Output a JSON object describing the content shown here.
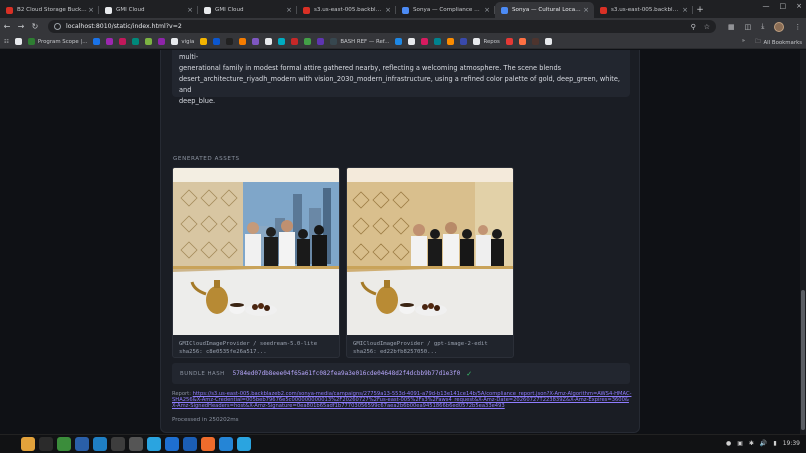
{
  "browser": {
    "tabs": [
      {
        "title": "B2 Cloud Storage Buckets",
        "color": "#d93025"
      },
      {
        "title": "GMI Cloud",
        "color": "#e8eaed"
      },
      {
        "title": "GMI Cloud",
        "color": "#e8eaed"
      },
      {
        "title": "s3.us-east-005.backblazeb2.c",
        "color": "#d93025"
      },
      {
        "title": "Sonya — Compliance Notar",
        "color": "#4c8bf5"
      },
      {
        "title": "Sonya — Cultural Localizatio",
        "color": "#4c8bf5",
        "active": true
      },
      {
        "title": "s3.us-east-005.backblazeb2.c",
        "color": "#d93025"
      }
    ],
    "url": "localhost:8010/static/index.html?v=2",
    "bookmarks": [
      {
        "label": "",
        "color": "#e8eaed"
      },
      {
        "label": "Program Scope |...",
        "color": "#2e7d32"
      },
      {
        "label": "",
        "color": "#1a73e8"
      },
      {
        "label": "",
        "color": "#9c27b0"
      },
      {
        "label": "",
        "color": "#c2185b"
      },
      {
        "label": "",
        "color": "#00897b"
      },
      {
        "label": "",
        "color": "#7cb342"
      },
      {
        "label": "",
        "color": "#8e24aa"
      },
      {
        "label": "vigia",
        "color": "#e8eaed"
      },
      {
        "label": "",
        "color": "#f4b400"
      },
      {
        "label": "",
        "color": "#0b57d0"
      },
      {
        "label": "",
        "color": "#212121"
      },
      {
        "label": "",
        "color": "#f57c00"
      },
      {
        "label": "",
        "color": "#7e57c2"
      },
      {
        "label": "",
        "color": "#e8eaed"
      },
      {
        "label": "",
        "color": "#00acc1"
      },
      {
        "label": "",
        "color": "#c62828"
      },
      {
        "label": "",
        "color": "#43a047"
      },
      {
        "label": "",
        "color": "#5e35b1"
      },
      {
        "label": "BASH REF — Ref...",
        "color": "#37474f"
      },
      {
        "label": "",
        "color": "#1e88e5"
      },
      {
        "label": "",
        "color": "#e8eaed"
      },
      {
        "label": "",
        "color": "#d81b60"
      },
      {
        "label": "",
        "color": "#00838f"
      },
      {
        "label": "",
        "color": "#fb8c00"
      },
      {
        "label": "",
        "color": "#3949ab"
      },
      {
        "label": "Repos",
        "color": "#e8eaed"
      },
      {
        "label": "",
        "color": "#e53935"
      },
      {
        "label": "",
        "color": "#ff7043"
      },
      {
        "label": "",
        "color": "#4e342e"
      },
      {
        "label": "",
        "color": "#e8eaed"
      }
    ],
    "all_bookmarks": "All Bookmarks"
  },
  "content": {
    "prompt_lines": [
      "nearby. The setting features a sleek modern interior with subtle geometric Islamic pattern accents on the wall, warm lighting, and a multi-",
      "generational family in modest formal attire gathered nearby, reflecting a welcoming atmosphere. The scene blends",
      "desert_architecture_riyadh_modern with vision_2030_modern_infrastructure, using a refined color palette of gold, deep_green, white, and",
      "deep_blue."
    ],
    "section_label": "GENERATED ASSETS",
    "assets": [
      {
        "provider": "GMICloudImageProvider / seedream-5.0-lite",
        "sha": "sha256: c8e0535fe26a517..."
      },
      {
        "provider": "GMICloudImageProvider / gpt-image-2-edit",
        "sha": "sha256: ed22bfb8257050..."
      }
    ],
    "bundle_label": "BUNDLE HASH",
    "bundle_hash": "5784ed07db8eee04f65a61fc082fea9a3e016cde04648d2f4dcbb9b77d1e3f0",
    "report_prefix": "Report:",
    "report_url": "https://s3.us-east-005.backblazeb2.com/sonya-media/campaigns/27759a13-553d-4091-a79d-b13e141ce14b/5A/compliance_report.json?X-Amz-Algorithm=AWS4-HMAC-SHA256&X-Amz-Credential=005beb79676e5c000000000013%2F20260727%2Fus-east-005%2Fs3%2Faws4_request&X-Amz-Date=20260727T223839Z&X-Amz-Expires=3600&X-Amz-SignedHeaders=host&X-Amz-Signature=0ea801b65adf1b77703056599c67aea2b6b00ea9451866b6ed0572b5ea33e493",
    "processed": "Processed in 250202ms"
  },
  "taskbar": {
    "apps": [
      {
        "name": "ubuntu-icon",
        "color": "#111214"
      },
      {
        "name": "files-icon",
        "color": "#e2a23b"
      },
      {
        "name": "terminal-icon",
        "color": "#2b2b2b"
      },
      {
        "name": "chrome-icon",
        "color": "#3b8d3b"
      },
      {
        "name": "mail-icon",
        "color": "#2a5fa8"
      },
      {
        "name": "vscode-icon",
        "color": "#1f7fc4"
      },
      {
        "name": "editor-icon",
        "color": "#3d3d3d"
      },
      {
        "name": "settings-icon",
        "color": "#555"
      },
      {
        "name": "telegram-icon",
        "color": "#2aa4e0"
      },
      {
        "name": "notes-icon",
        "color": "#1e6fd0"
      },
      {
        "name": "screenshot-icon",
        "color": "#1b5eb5"
      },
      {
        "name": "postman-icon",
        "color": "#ef6c2c"
      },
      {
        "name": "code-icon",
        "color": "#2585d6"
      },
      {
        "name": "telegram2-icon",
        "color": "#2aa4e0"
      }
    ],
    "clock": "19:39"
  }
}
